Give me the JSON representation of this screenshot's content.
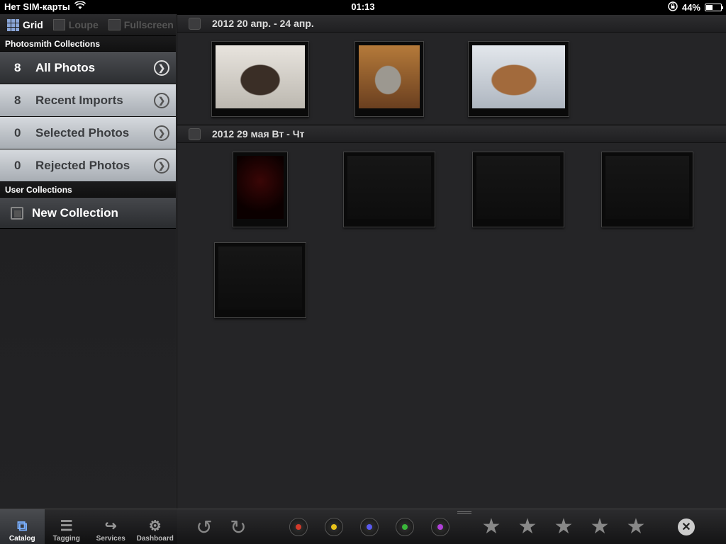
{
  "status": {
    "carrier": "Нет SIM-карты",
    "time": "01:13",
    "battery": "44%",
    "battery_level": 0.44
  },
  "viewmodes": [
    {
      "label": "Grid",
      "active": true
    },
    {
      "label": "Loupe",
      "active": false
    },
    {
      "label": "Fullscreen",
      "active": false
    }
  ],
  "sidebar": {
    "photosmith_header": "Photosmith Collections",
    "collections": [
      {
        "count": "8",
        "name": "All Photos",
        "style": "dark"
      },
      {
        "count": "8",
        "name": "Recent Imports",
        "style": "light"
      },
      {
        "count": "0",
        "name": "Selected Photos",
        "style": "light"
      },
      {
        "count": "0",
        "name": "Rejected Photos",
        "style": "light"
      }
    ],
    "user_header": "User Collections",
    "new_collection": "New Collection"
  },
  "groups": [
    {
      "title": "2012 20 апр. - 24 апр.",
      "photos": [
        "monkeys",
        "chinchilla",
        "squirrel"
      ]
    },
    {
      "title": "2012 29 мая Вт - Чт",
      "photos": [
        "dark-dialog",
        "screenshot",
        "screenshot",
        "screenshot",
        "screenshot"
      ]
    }
  ],
  "tabs": [
    {
      "label": "Catalog",
      "icon": "catalog-icon",
      "active": true
    },
    {
      "label": "Tagging",
      "icon": "list-icon",
      "active": false
    },
    {
      "label": "Services",
      "icon": "share-icon",
      "active": false
    },
    {
      "label": "Dashboard",
      "icon": "gear-icon",
      "active": false
    }
  ],
  "toolbar": {
    "rotate": [
      "rotate-left-icon",
      "rotate-right-icon"
    ],
    "color_labels": [
      "#d43a2a",
      "#e8c21a",
      "#5a5af0",
      "#3ab53a",
      "#b040d8"
    ],
    "stars": 5
  }
}
